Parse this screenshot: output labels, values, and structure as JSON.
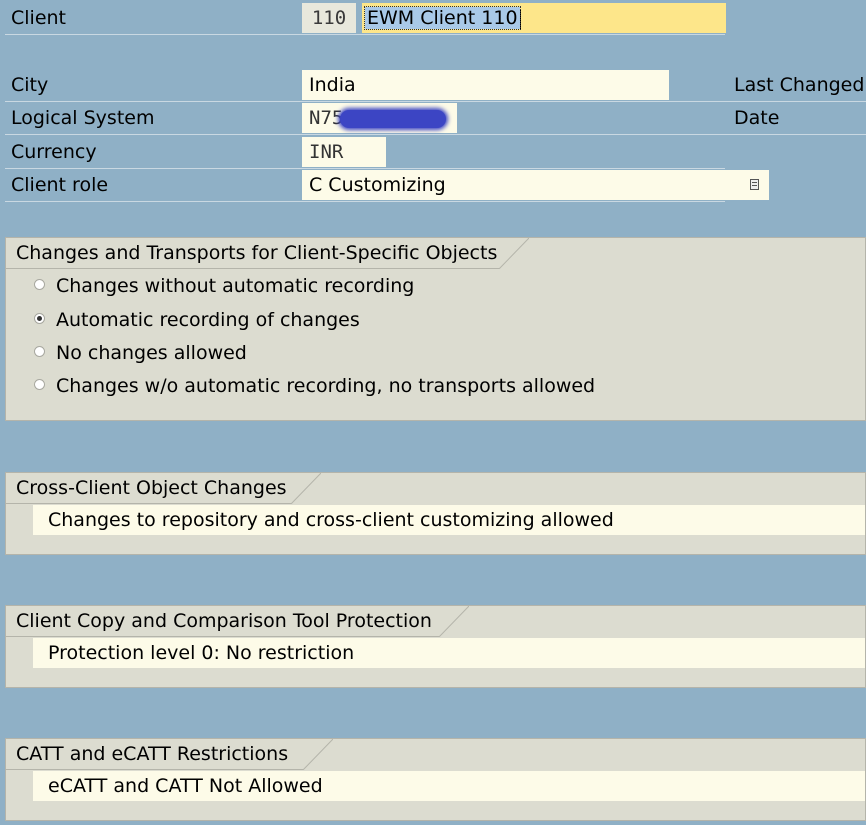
{
  "header": {
    "client_label": "Client",
    "client_number": "110",
    "client_name": "EWM Client 110"
  },
  "details": {
    "city_label": "City",
    "city_value": "India",
    "logical_system_label": "Logical System",
    "logical_system_value": "N75",
    "currency_label": "Currency",
    "currency_value": "INR",
    "client_role_label": "Client role",
    "client_role_value": "C Customizing",
    "last_changed_label": "Last Changed",
    "date_label": "Date"
  },
  "changes_transports": {
    "title": "Changes and Transports for Client-Specific Objects",
    "options": [
      {
        "label": "Changes without automatic recording",
        "selected": false
      },
      {
        "label": "Automatic recording of changes",
        "selected": true
      },
      {
        "label": "No changes allowed",
        "selected": false
      },
      {
        "label": "Changes w/o automatic recording, no transports allowed",
        "selected": false
      }
    ]
  },
  "cross_client": {
    "title": "Cross-Client Object Changes",
    "value": "Changes to repository and cross-client customizing allowed"
  },
  "copy_protection": {
    "title": "Client Copy and Comparison Tool Protection",
    "value": "Protection level 0: No restriction"
  },
  "catt": {
    "title": "CATT and eCATT Restrictions",
    "value": "eCATT and CATT Not Allowed"
  },
  "colors": {
    "background": "#8fb0c6",
    "input_bg": "#fdfbe8",
    "focused_input_bg": "#fde68a",
    "group_bg": "#dcdcd0",
    "redaction": "#3c45c4"
  },
  "icons": {
    "value_help": "value-help-icon",
    "radio_button": "radio-button-icon"
  }
}
